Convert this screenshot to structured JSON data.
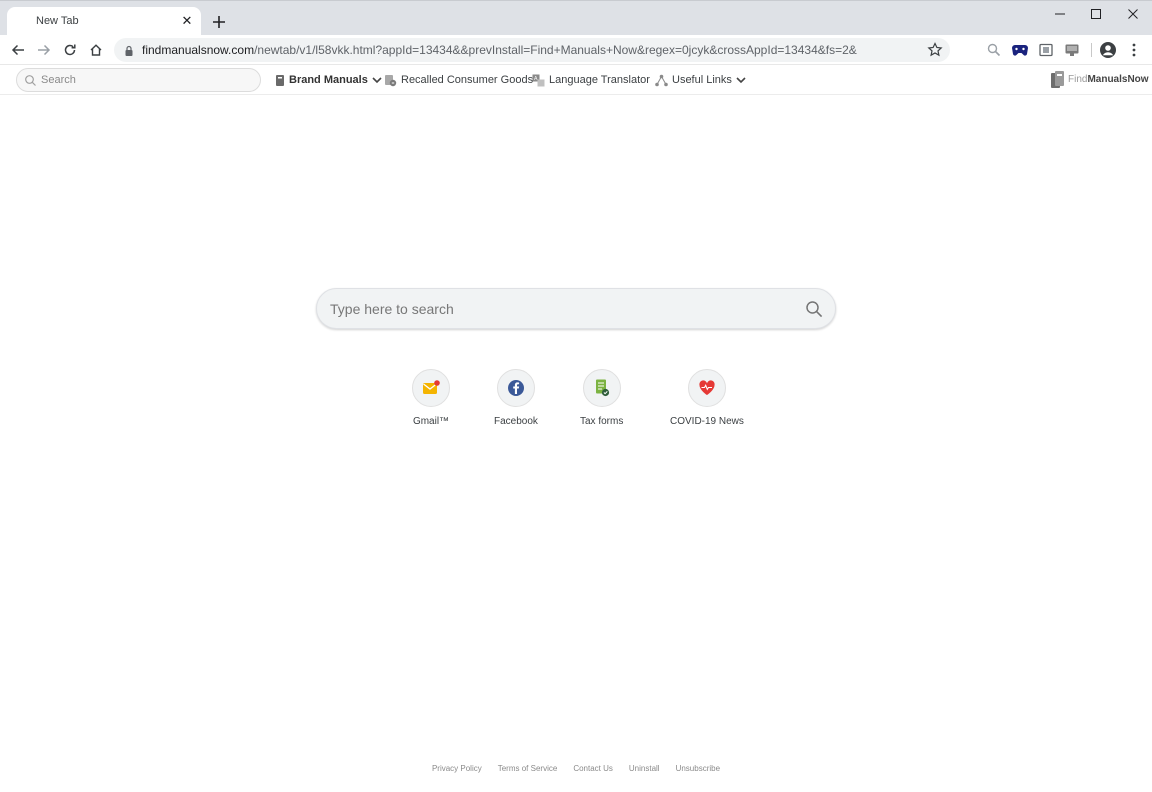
{
  "browser": {
    "tab": {
      "title": "New Tab"
    },
    "address": {
      "domain": "findmanualsnow.com",
      "path": "/newtab/v1/l58vkk.html?appId=13434&&prevInstall=Find+Manuals+Now&regex=0jcyk&crossAppId=13434&fs=2&"
    }
  },
  "extension_bar": {
    "search_placeholder": "Search",
    "brand_manuals": "Brand Manuals",
    "recalled": "Recalled Consumer Goods",
    "translator": "Language Translator",
    "useful_links": "Useful Links",
    "logo_find": "Find",
    "logo_rest": "ManualsNow"
  },
  "main": {
    "search_placeholder": "Type here to search",
    "shortcuts": [
      {
        "label": "Gmail™",
        "icon": "gmail-icon"
      },
      {
        "label": "Facebook",
        "icon": "facebook-icon"
      },
      {
        "label": "Tax forms",
        "icon": "tax-forms-icon"
      },
      {
        "label": "COVID-19 News",
        "icon": "covid-news-icon"
      }
    ]
  },
  "footer": {
    "links": [
      "Privacy Policy",
      "Terms of Service",
      "Contact Us",
      "Uninstall",
      "Unsubscribe"
    ]
  },
  "colors": {
    "tabstrip": "#dee1e6",
    "omnibox": "#f1f3f4",
    "facebook": "#3b5998",
    "gmail": "#f4b400",
    "covid": "#e53935",
    "tax": "#7cb342"
  }
}
